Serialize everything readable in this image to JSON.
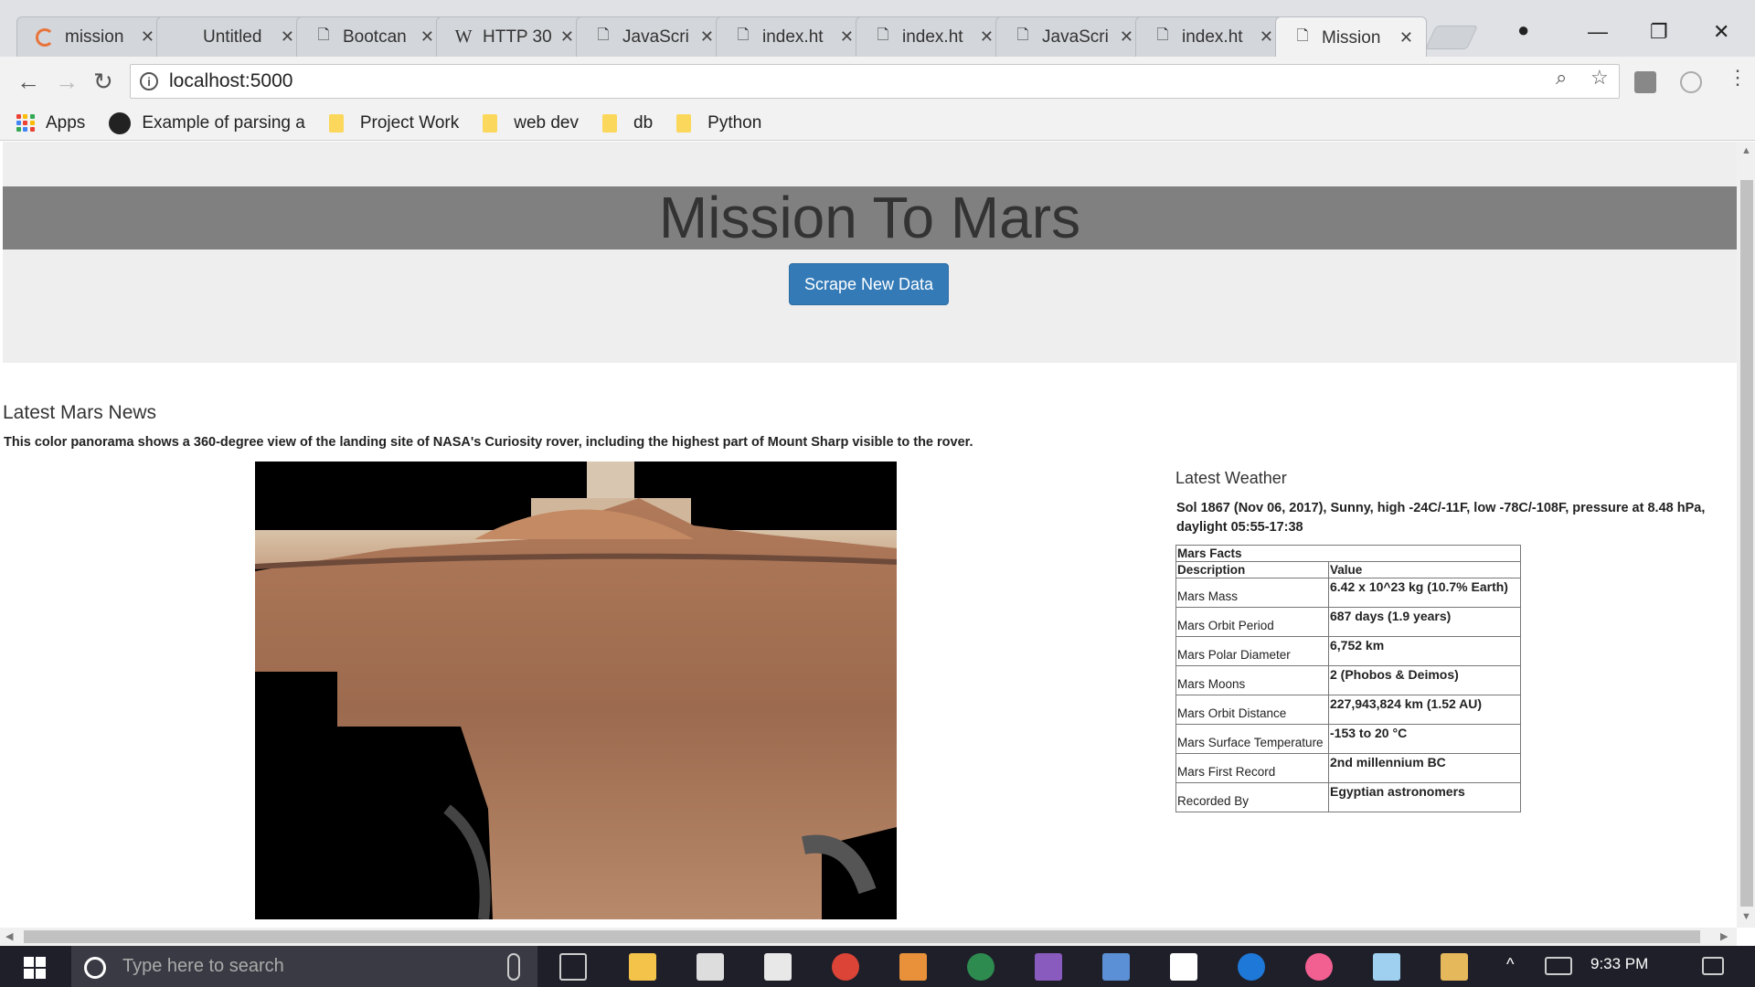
{
  "browser": {
    "tabs": [
      {
        "title": "mission",
        "icon": "loading-spinner-icon"
      },
      {
        "title": "Untitled",
        "icon": "none"
      },
      {
        "title": "Bootcan",
        "icon": "page-icon"
      },
      {
        "title": "HTTP 30",
        "icon": "wikipedia-icon"
      },
      {
        "title": "JavaScri",
        "icon": "page-icon"
      },
      {
        "title": "index.ht",
        "icon": "page-icon"
      },
      {
        "title": "index.ht",
        "icon": "page-icon"
      },
      {
        "title": "JavaScri",
        "icon": "page-icon"
      },
      {
        "title": "index.ht",
        "icon": "page-icon"
      },
      {
        "title": "Mission",
        "icon": "page-icon",
        "active": true
      }
    ],
    "url": "localhost:5000",
    "bookmarks": [
      {
        "label": "Apps",
        "icon": "apps-grid-icon"
      },
      {
        "label": "Example of parsing a",
        "icon": "github-icon"
      },
      {
        "label": "Project Work",
        "icon": "folder-icon"
      },
      {
        "label": "web dev",
        "icon": "folder-icon"
      },
      {
        "label": "db",
        "icon": "folder-icon"
      },
      {
        "label": "Python",
        "icon": "folder-icon"
      }
    ]
  },
  "page": {
    "title": "Mission To Mars",
    "scrape_button": "Scrape New Data",
    "news": {
      "heading": "Latest Mars News",
      "paragraph": "This color panorama shows a 360-degree view of the landing site of NASA's Curiosity rover, including the highest part of Mount Sharp visible to the rover."
    },
    "weather": {
      "heading": "Latest Weather",
      "text": "Sol 1867 (Nov 06, 2017), Sunny, high -24C/-11F, low -78C/-108F, pressure at 8.48 hPa, daylight 05:55-17:38"
    },
    "facts": {
      "caption": "Mars Facts",
      "headers": [
        "Description",
        "Value"
      ],
      "rows": [
        {
          "description": "Mars Mass",
          "value": "6.42 x 10^23 kg (10.7% Earth)"
        },
        {
          "description": "Mars Orbit Period",
          "value": "687 days (1.9 years)"
        },
        {
          "description": "Mars Polar Diameter",
          "value": "6,752 km"
        },
        {
          "description": "Mars Moons",
          "value": "2 (Phobos & Deimos)"
        },
        {
          "description": "Mars Orbit Distance",
          "value": "227,943,824 km (1.52 AU)"
        },
        {
          "description": "Mars Surface Temperature",
          "value": "-153 to 20 °C"
        },
        {
          "description": "Mars First Record",
          "value": "2nd millennium BC"
        },
        {
          "description": "Recorded By",
          "value": "Egyptian astronomers"
        }
      ]
    }
  },
  "taskbar": {
    "search_placeholder": "Type here to search",
    "time": "9:33 PM"
  },
  "colors": {
    "button_bg": "#337ab7",
    "banner_bg": "#808080",
    "jumbotron_bg": "#eeeeee"
  }
}
